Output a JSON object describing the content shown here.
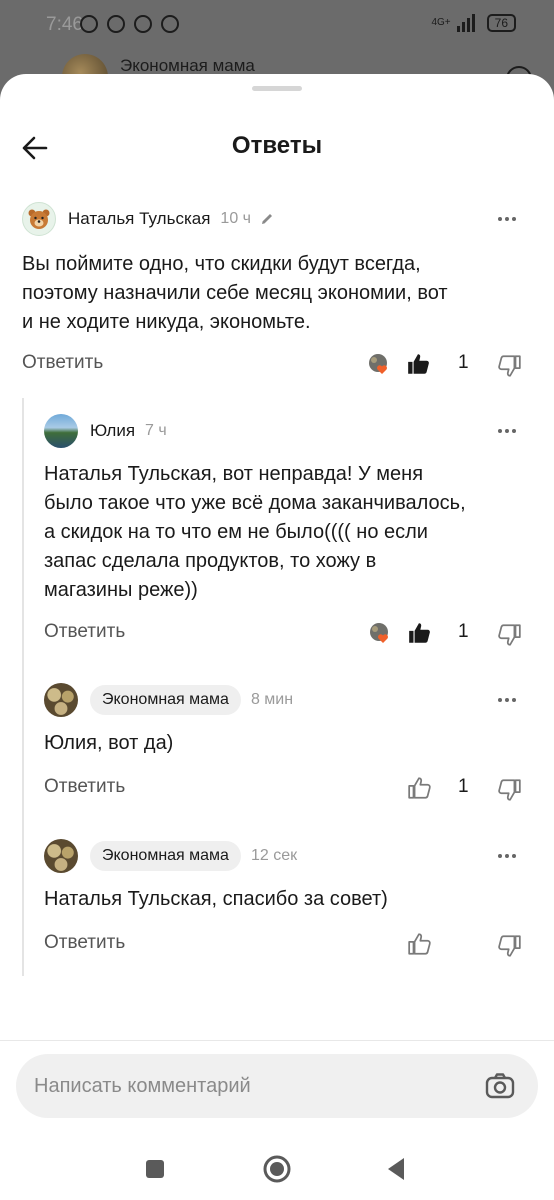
{
  "status_bar": {
    "time": "7:46",
    "network": "4G+",
    "battery": "76"
  },
  "behind": {
    "title": "Экономная мама"
  },
  "header": {
    "title": "Ответы"
  },
  "comments": [
    {
      "author": "Наталья Тульская",
      "time": "10 ч",
      "text_lines": [
        "Вы поймите одно, что скидки будут всегда,",
        "поэтому назначили себе месяц экономии, вот",
        "и не ходите никуда, экономьте."
      ],
      "reply_label": "Ответить",
      "likes": "1"
    },
    {
      "author": "Юлия",
      "time": "7 ч",
      "text_lines": [
        "Наталья Тульская, вот неправда! У меня",
        "было такое что уже всё дома заканчивалось,",
        "а скидок на то что ем не было(((( но если",
        "запас сделала продуктов, то хожу в",
        "магазины реже))"
      ],
      "reply_label": "Ответить",
      "likes": "1"
    },
    {
      "author": "Экономная мама",
      "time": "8 мин",
      "text_lines": [
        "Юлия, вот да)"
      ],
      "reply_label": "Ответить",
      "likes": "1"
    },
    {
      "author": "Экономная мама",
      "time": "12 сек",
      "text_lines": [
        "Наталья Тульская, спасибо за совет)"
      ],
      "reply_label": "Ответить",
      "likes": ""
    }
  ],
  "composer": {
    "placeholder": "Написать комментарий"
  },
  "colors": {
    "heart_reaction": "#f0602a",
    "like_active": "#1a1a1a",
    "text_muted": "#9a9a9a"
  },
  "icons": [
    "back-arrow-icon",
    "edit-pencil-icon",
    "more-dots-icon",
    "like-icon",
    "dislike-icon",
    "heart-reaction-icon",
    "camera-icon",
    "nav-square-icon",
    "nav-home-icon",
    "nav-back-icon"
  ]
}
